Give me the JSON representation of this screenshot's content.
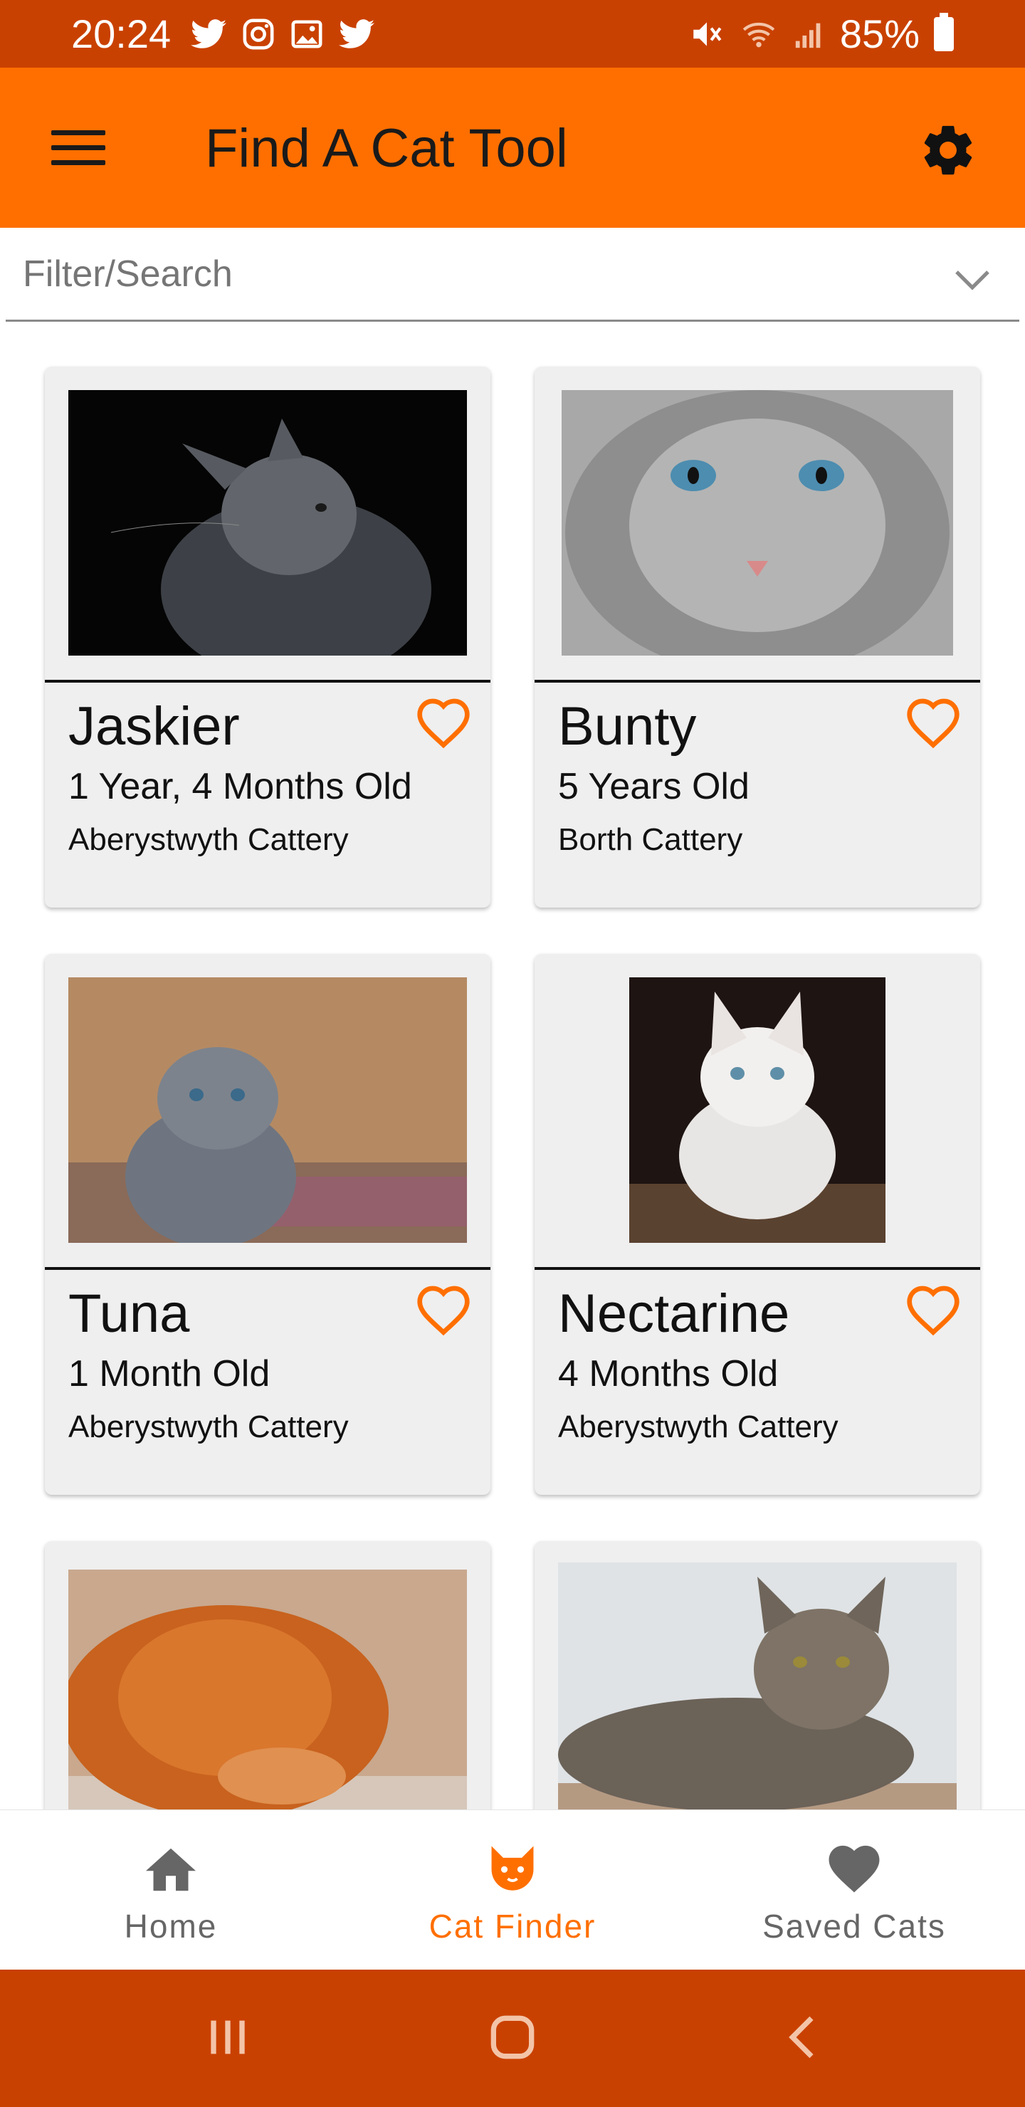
{
  "status_bar": {
    "time": "20:24",
    "battery": "85%",
    "icons": [
      "twitter-icon",
      "instagram-icon",
      "gallery-icon",
      "twitter-icon",
      "mute-icon",
      "wifi-icon",
      "signal-icon",
      "battery-icon"
    ]
  },
  "app_bar": {
    "title": "Find A Cat Tool",
    "menu_icon": "hamburger-menu-icon",
    "settings_icon": "gear-icon"
  },
  "filter": {
    "placeholder": "Filter/Search",
    "icon": "chevron-down-icon"
  },
  "cats": [
    {
      "name": "Jaskier",
      "age": "1 Year, 4 Months Old",
      "cattery": "Aberystwyth Cattery",
      "photo": "grey-kitten-looking-up"
    },
    {
      "name": "Bunty",
      "age": "5 Years Old",
      "cattery": "Borth Cattery",
      "photo": "grey-tabby-blue-eyes"
    },
    {
      "name": "Tuna",
      "age": "1 Month Old",
      "cattery": "Aberystwyth Cattery",
      "photo": "grey-fold-kitten"
    },
    {
      "name": "Nectarine",
      "age": "4 Months Old",
      "cattery": "Aberystwyth Cattery",
      "photo": "white-kitten"
    },
    {
      "name": "",
      "age": "",
      "cattery": "",
      "photo": "orange-cat-sleeping"
    },
    {
      "name": "",
      "age": "",
      "cattery": "",
      "photo": "tabby-cat-lying"
    }
  ],
  "bottom_nav": {
    "items": [
      {
        "label": "Home",
        "icon": "home-icon",
        "active": false
      },
      {
        "label": "Cat Finder",
        "icon": "cat-face-icon",
        "active": true
      },
      {
        "label": "Saved Cats",
        "icon": "heart-icon",
        "active": false
      }
    ]
  },
  "colors": {
    "status_bar": "#c94100",
    "app_bar": "#ff6f00",
    "accent": "#ff6f00",
    "card_bg": "#efefef",
    "nav_inactive": "#666666"
  }
}
